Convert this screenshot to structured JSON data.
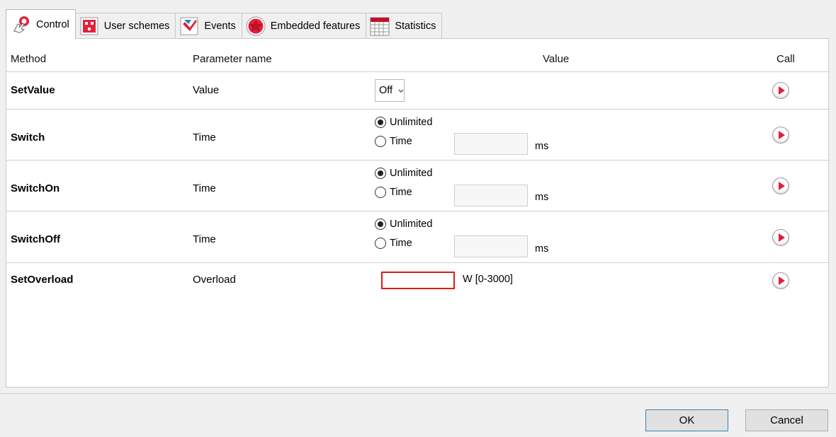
{
  "tabs": [
    {
      "label": "Control",
      "icon": "hand-pointer-icon",
      "active": true
    },
    {
      "label": "User schemes",
      "icon": "user-schemes-icon",
      "active": false
    },
    {
      "label": "Events",
      "icon": "events-icon",
      "active": false
    },
    {
      "label": "Embedded features",
      "icon": "star-icon",
      "active": false
    },
    {
      "label": "Statistics",
      "icon": "calendar-icon",
      "active": false
    }
  ],
  "columns": {
    "method": "Method",
    "parameter": "Parameter name",
    "value": "Value",
    "call": "Call"
  },
  "rows": [
    {
      "method": "SetValue",
      "param": "Value",
      "select_value": "Off"
    },
    {
      "method": "Switch",
      "param": "Time",
      "radio_unlimited": "Unlimited",
      "radio_time": "Time",
      "time_value": "",
      "unit": "ms"
    },
    {
      "method": "SwitchOn",
      "param": "Time",
      "radio_unlimited": "Unlimited",
      "radio_time": "Time",
      "time_value": "",
      "unit": "ms"
    },
    {
      "method": "SwitchOff",
      "param": "Time",
      "radio_unlimited": "Unlimited",
      "radio_time": "Time",
      "time_value": "",
      "unit": "ms"
    },
    {
      "method": "SetOverload",
      "param": "Overload",
      "overload_value": "",
      "unit": "W [0-3000]"
    }
  ],
  "buttons": {
    "ok": "OK",
    "cancel": "Cancel"
  },
  "colors": {
    "accent_red": "#e0203a",
    "error_border": "#e01919",
    "ok_border": "#3c7fb1"
  }
}
